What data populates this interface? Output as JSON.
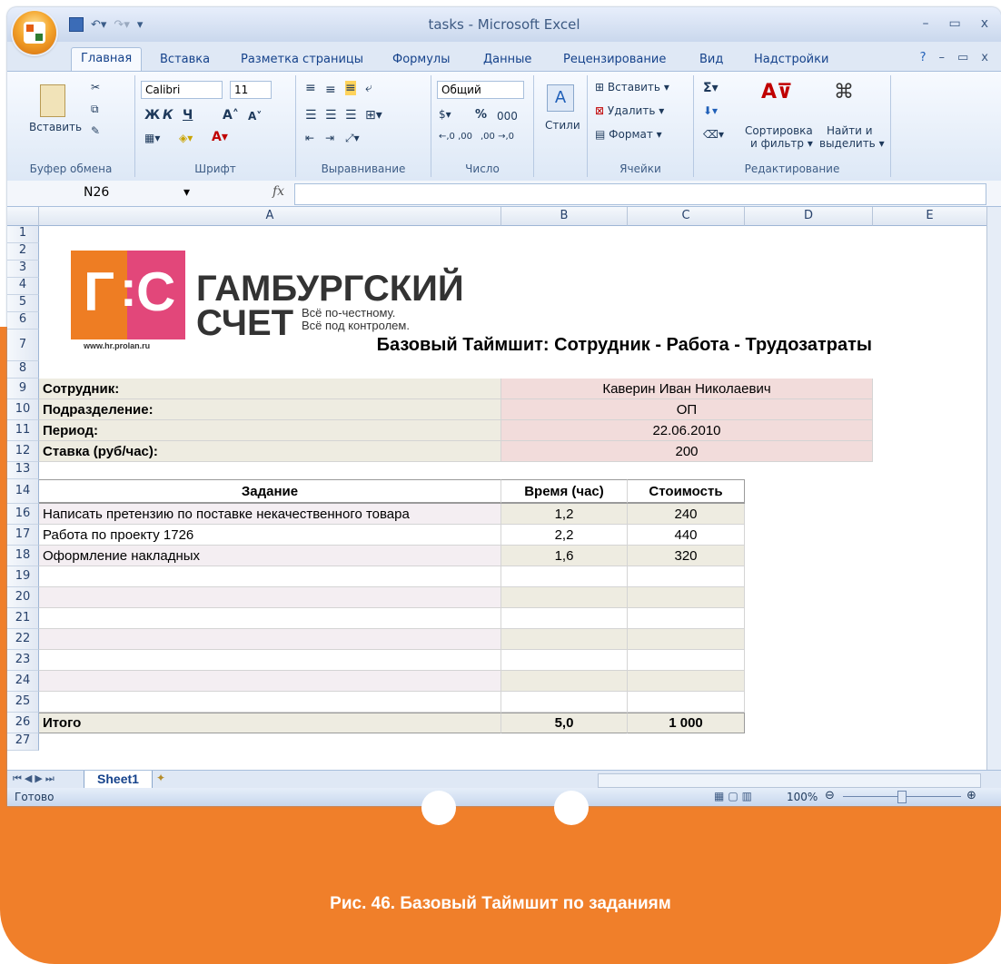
{
  "window": {
    "title": "tasks - Microsoft Excel"
  },
  "tabs": [
    "Главная",
    "Вставка",
    "Разметка страницы",
    "Формулы",
    "Данные",
    "Рецензирование",
    "Вид",
    "Надстройки"
  ],
  "ribbon": {
    "paste": "Вставить",
    "clipboard": "Буфер обмена",
    "font_name": "Calibri",
    "font_size": "11",
    "font_group": "Шрифт",
    "bold": "Ж",
    "italic": "К",
    "underline": "Ч",
    "align_group": "Выравнивание",
    "number_format": "Общий",
    "number_group": "Число",
    "percent": "%",
    "thousands": "000",
    "dec_inc": "←,0 ,00",
    "dec_dec": ",00 →,0",
    "styles": "Стили",
    "insert": "Вставить",
    "delete": "Удалить",
    "format": "Формат",
    "cells_group": "Ячейки",
    "sort_filter_1": "Сортировка",
    "sort_filter_2": "и фильтр",
    "find_1": "Найти и",
    "find_2": "выделить",
    "editing_group": "Редактирование"
  },
  "formula_bar": {
    "cell_ref": "N26",
    "fx": "fx",
    "value": ""
  },
  "columns": [
    "A",
    "B",
    "C",
    "D",
    "E"
  ],
  "rows": [
    "1",
    "2",
    "3",
    "4",
    "5",
    "6",
    "7",
    "8",
    "9",
    "10",
    "11",
    "12",
    "13",
    "14",
    "16",
    "17",
    "18",
    "19",
    "20",
    "21",
    "22",
    "23",
    "24",
    "25",
    "26",
    "27"
  ],
  "logo": {
    "letter_g": "Г",
    "colon": ":",
    "letter_c": "С",
    "line1": "ГАМБУРГСКИЙ",
    "line2": "СЧЕТ",
    "tagline1": "Всё по-честному.",
    "tagline2": "Всё под контролем.",
    "url": "www.hr.prolan.ru"
  },
  "sheet_title": "Базовый Таймшит:  Сотрудник - Работа - Трудозатраты",
  "info": [
    {
      "label": "Сотрудник:",
      "value": "Каверин Иван Николаевич"
    },
    {
      "label": "Подразделение:",
      "value": "ОП"
    },
    {
      "label": "Период:",
      "value": "22.06.2010"
    },
    {
      "label": "Ставка (руб/час):",
      "value": "200"
    }
  ],
  "table": {
    "headers": [
      "Задание",
      "Время (час)",
      "Стоимость"
    ],
    "rows": [
      [
        "Написать претензию по поставке некачественного товара",
        "1,2",
        "240"
      ],
      [
        "Работа по проекту 1726",
        "2,2",
        "440"
      ],
      [
        "Оформление накладных",
        "1,6",
        "320"
      ]
    ],
    "total": [
      "Итого",
      "5,0",
      "1 000"
    ]
  },
  "sheet_tab": "Sheet1",
  "status": {
    "ready": "Готово",
    "zoom": "100%"
  },
  "caption": "Рис. 46. Базовый Таймшит по заданиям",
  "colors": {
    "accent_orange": "#f07f2a",
    "logo_orange": "#ee7d23",
    "logo_pink": "#e2477a",
    "info_fill": "#f2dcdb",
    "label_fill": "#eeece1",
    "row_fill": "#f4eef2"
  }
}
